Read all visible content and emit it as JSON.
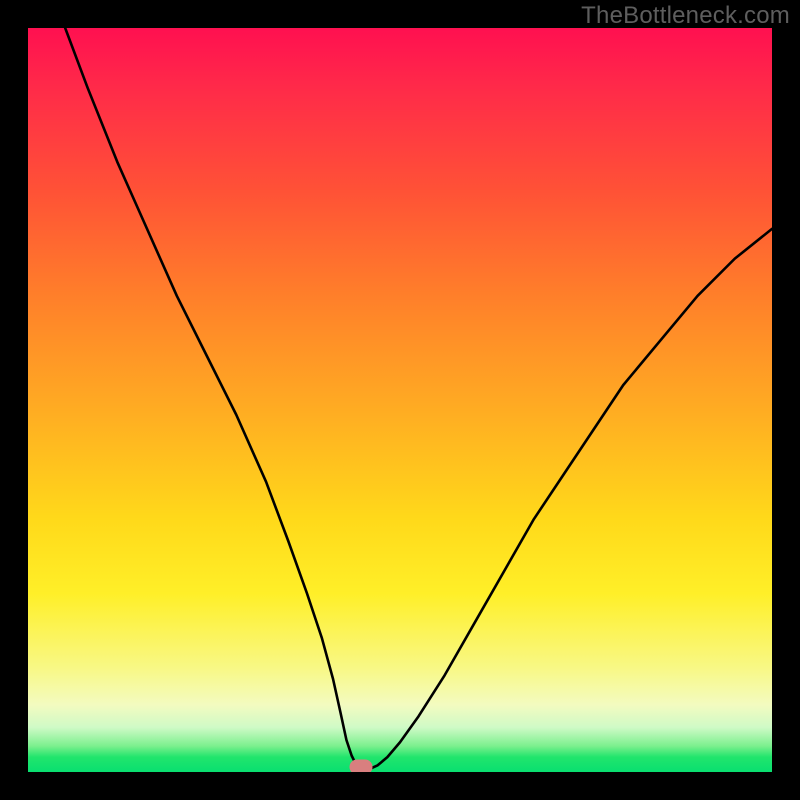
{
  "watermark": "TheBottleneck.com",
  "chart_data": {
    "type": "line",
    "title": "",
    "xlabel": "",
    "ylabel": "",
    "xlim": [
      0,
      100
    ],
    "ylim": [
      0,
      100
    ],
    "grid": false,
    "legend": false,
    "series": [
      {
        "name": "curve",
        "x": [
          5,
          8,
          12,
          16,
          20,
          24,
          28,
          32,
          35,
          37.5,
          39.5,
          41,
          42,
          42.8,
          43.5,
          44,
          44.6,
          45.2,
          46,
          47,
          48.3,
          50,
          52.5,
          56,
          60,
          64,
          68,
          72,
          76,
          80,
          85,
          90,
          95,
          100
        ],
        "y": [
          100,
          92,
          82,
          73,
          64,
          56,
          48,
          39,
          31,
          24,
          18,
          12.5,
          8,
          4.3,
          2.2,
          1.2,
          0.6,
          0.45,
          0.45,
          0.9,
          2,
          4,
          7.5,
          13,
          20,
          27,
          34,
          40,
          46,
          52,
          58,
          64,
          69,
          73
        ],
        "color": "#000000"
      }
    ],
    "marker": {
      "x": 44.7,
      "y": 0.7,
      "color": "#d97f7f"
    },
    "background_gradient": [
      "#ff1050",
      "#ffd91a",
      "#09df70"
    ]
  }
}
